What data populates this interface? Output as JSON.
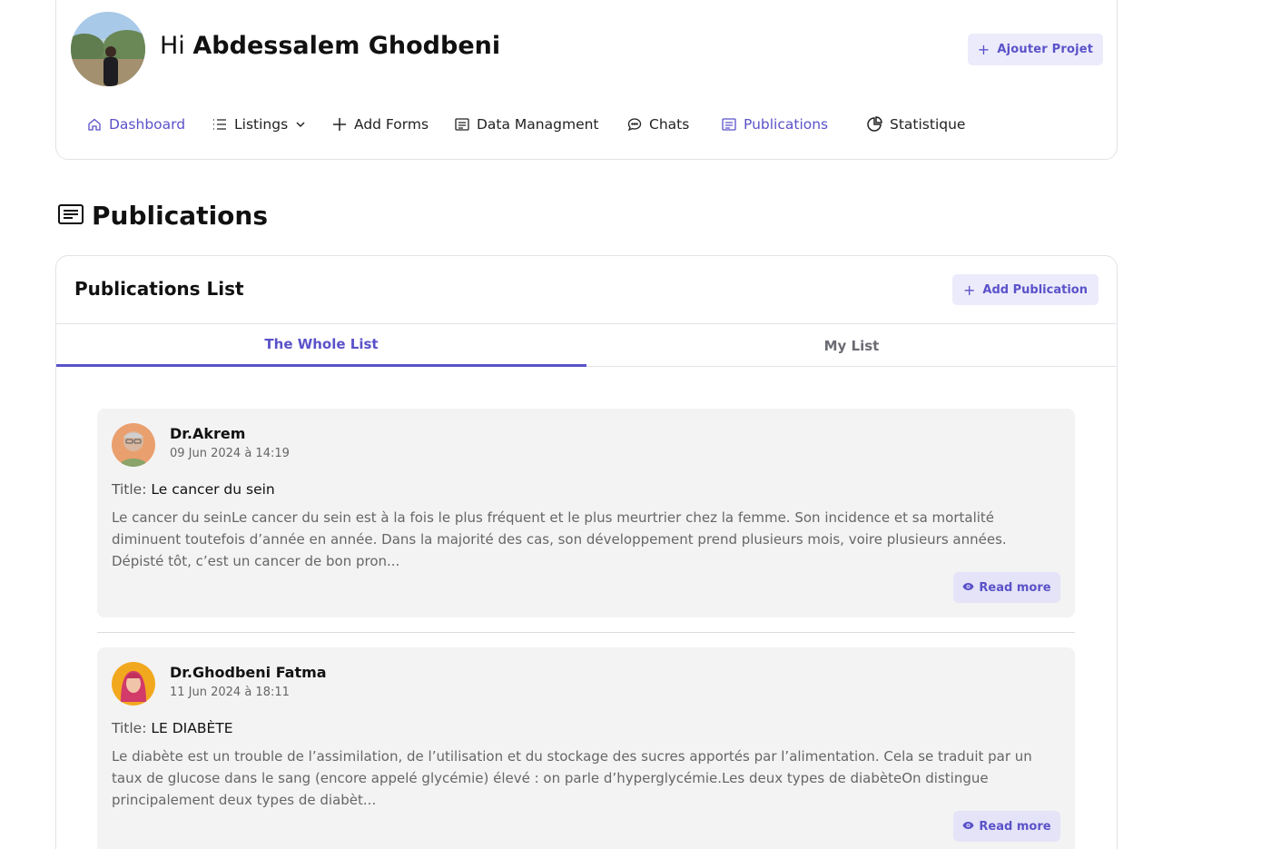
{
  "header": {
    "greeting_prefix": "Hi",
    "user_name": "Abdessalem Ghodbeni",
    "add_project_label": "Ajouter Projet",
    "add_project_icon": "plus-icon"
  },
  "nav": {
    "items": [
      {
        "label": "Dashboard",
        "icon": "home-icon",
        "active": true
      },
      {
        "label": "Listings",
        "icon": "list-icon",
        "active": false,
        "dropdown": true
      },
      {
        "label": "Add Forms",
        "icon": "plus-icon",
        "active": false
      },
      {
        "label": "Data Managment",
        "icon": "document-icon",
        "active": false
      },
      {
        "label": "Chats",
        "icon": "chat-icon",
        "active": false
      },
      {
        "label": "Publications",
        "icon": "newspaper-icon",
        "active": true
      },
      {
        "label": "Statistique",
        "icon": "pie-chart-icon",
        "active": false
      }
    ]
  },
  "page": {
    "title": "Publications",
    "title_icon": "newspaper-icon"
  },
  "list": {
    "title": "Publications List",
    "add_label": "Add Publication",
    "tabs": [
      {
        "label": "The Whole List",
        "active": true
      },
      {
        "label": "My List",
        "active": false
      }
    ],
    "posts": [
      {
        "author": "Dr.Akrem",
        "date": "09 Jun 2024 à 14:19",
        "title_label": "Title:",
        "title": "Le cancer du sein",
        "excerpt": "Le cancer du seinLe cancer du sein est à la fois le plus fréquent et le plus meurtrier chez la femme. Son incidence et sa mortalité diminuent toutefois d’année en année. Dans la majorité des cas, son développement prend plusieurs mois, voire plusieurs années. Dépisté tôt, c’est un cancer de bon pron...",
        "read_more": "Read more"
      },
      {
        "author": "Dr.Ghodbeni Fatma",
        "date": "11 Jun 2024 à 18:11",
        "title_label": "Title:",
        "title": "LE DIABÈTE",
        "excerpt": "Le diabète est un trouble de l’assimilation, de l’utilisation et du stockage des sucres apportés par l’alimentation. Cela se traduit par un taux de glucose dans le sang (encore appelé glycémie) élevé : on parle d’hyperglycémie.Les deux types de diabèteOn distingue principalement deux types de diabèt...",
        "read_more": "Read more"
      }
    ]
  },
  "colors": {
    "accent": "#5a52c9",
    "accent_bg": "#ecebfb",
    "card_bg": "#f3f3f4"
  }
}
